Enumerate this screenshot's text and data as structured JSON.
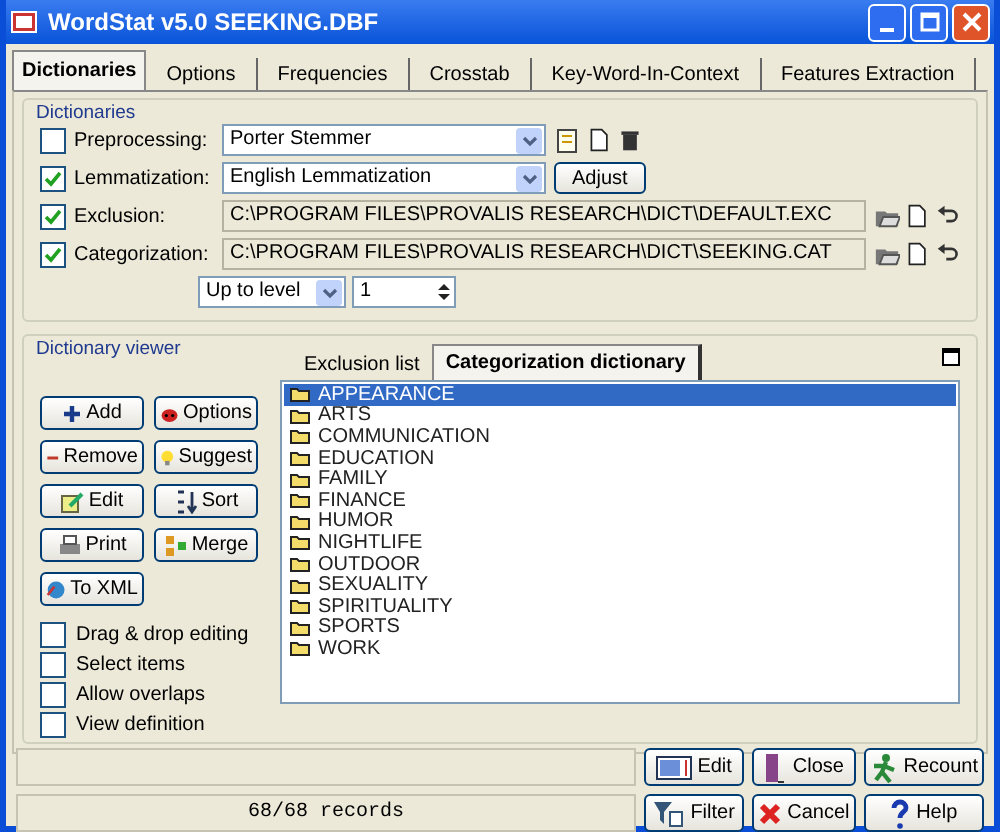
{
  "window": {
    "title": "WordStat v5.0  SEEKING.DBF"
  },
  "tabs": [
    {
      "label": "Dictionaries",
      "selected": true
    },
    {
      "label": "Options",
      "selected": false
    },
    {
      "label": "Frequencies",
      "selected": false
    },
    {
      "label": "Crosstab",
      "selected": false
    },
    {
      "label": "Key-Word-In-Context",
      "selected": false
    },
    {
      "label": "Features Extraction",
      "selected": false
    }
  ],
  "dictionaries": {
    "title": "Dictionaries",
    "rows": [
      {
        "kind": "combo",
        "label": "Preprocessing:",
        "checked": false,
        "value": "Porter Stemmer"
      },
      {
        "kind": "combo",
        "label": "Lemmatization:",
        "checked": true,
        "value": "English Lemmatization",
        "button": "Adjust"
      },
      {
        "kind": "path",
        "label": "Exclusion:",
        "checked": true,
        "value": "C:\\PROGRAM FILES\\PROVALIS RESEARCH\\DICT\\DEFAULT.EXC"
      },
      {
        "kind": "path",
        "label": "Categorization:",
        "checked": true,
        "value": "C:\\PROGRAM FILES\\PROVALIS RESEARCH\\DICT\\SEEKING.CAT"
      }
    ],
    "level_mode": "Up to level",
    "level_value": "1"
  },
  "viewer": {
    "title": "Dictionary viewer",
    "buttons": [
      {
        "label": "Add"
      },
      {
        "label": "Options"
      },
      {
        "label": "Remove"
      },
      {
        "label": "Suggest"
      },
      {
        "label": "Edit"
      },
      {
        "label": "Sort"
      },
      {
        "label": "Print"
      },
      {
        "label": "Merge"
      },
      {
        "label": "To XML"
      }
    ],
    "options": [
      {
        "label": "Drag & drop editing",
        "checked": false
      },
      {
        "label": "Select items",
        "checked": false
      },
      {
        "label": "Allow overlaps",
        "checked": false
      },
      {
        "label": "View definition",
        "checked": false
      }
    ],
    "tabs": [
      {
        "label": "Exclusion list",
        "selected": false
      },
      {
        "label": "Categorization dictionary",
        "selected": true
      }
    ],
    "items": [
      {
        "label": "APPEARANCE",
        "selected": true
      },
      {
        "label": "ARTS",
        "selected": false
      },
      {
        "label": "COMMUNICATION",
        "selected": false
      },
      {
        "label": "EDUCATION",
        "selected": false
      },
      {
        "label": "FAMILY",
        "selected": false
      },
      {
        "label": "FINANCE",
        "selected": false
      },
      {
        "label": "HUMOR",
        "selected": false
      },
      {
        "label": "NIGHTLIFE",
        "selected": false
      },
      {
        "label": "OUTDOOR",
        "selected": false
      },
      {
        "label": "SEXUALITY",
        "selected": false
      },
      {
        "label": "SPIRITUALITY",
        "selected": false
      },
      {
        "label": "SPORTS",
        "selected": false
      },
      {
        "label": "WORK",
        "selected": false
      }
    ]
  },
  "status_bar": {
    "records": "68/68 records"
  },
  "buttons": [
    {
      "label": "Edit"
    },
    {
      "label": "Close"
    },
    {
      "label": "Recount"
    },
    {
      "label": "Filter"
    },
    {
      "label": "Cancel"
    },
    {
      "label": "Help"
    }
  ]
}
